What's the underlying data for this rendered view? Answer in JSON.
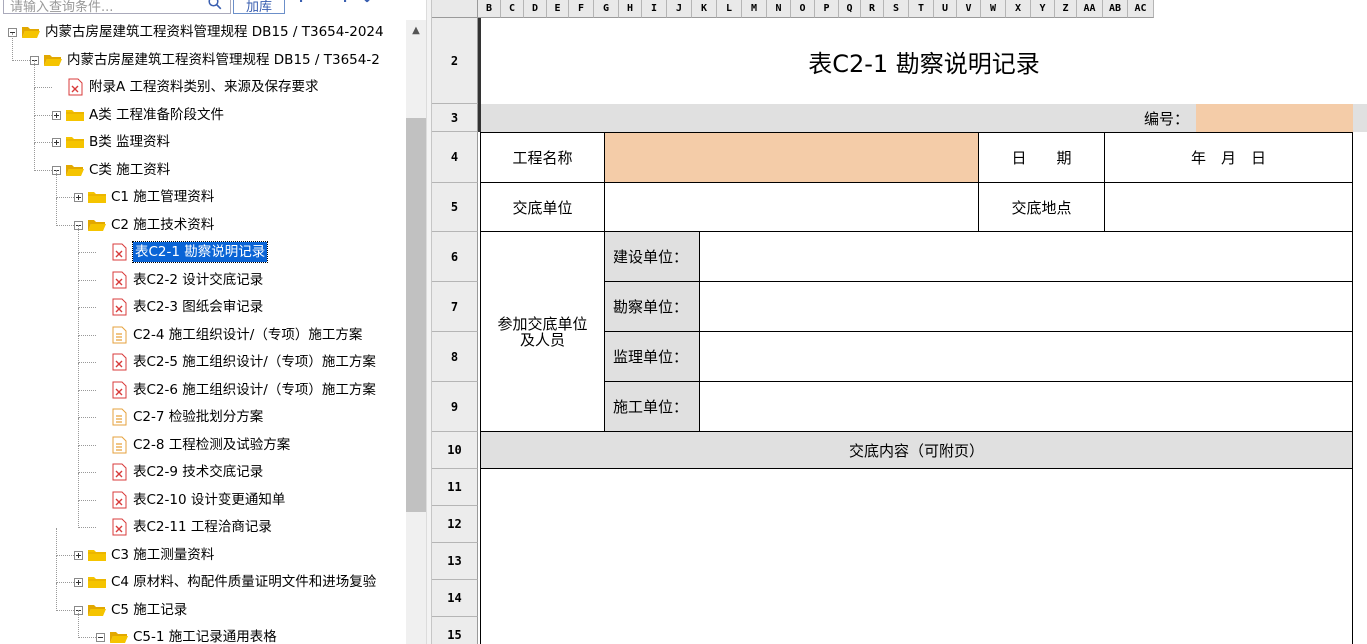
{
  "left_panel": {
    "search_placeholder": "请输入查询条件...",
    "load_button": "加库",
    "tree": [
      {
        "label": "内蒙古房屋建筑工程资料管理规程 DB15 / T3654-2024",
        "icon": "folder-icon",
        "state": "open"
      },
      {
        "label": "内蒙古房屋建筑工程资料管理规程 DB15 / T3654-2",
        "icon": "folder-icon",
        "state": "open"
      },
      {
        "label": "附录A  工程资料类别、来源及保存要求",
        "icon": "excel-file-icon",
        "state": "leaf"
      },
      {
        "label": "A类 工程准备阶段文件",
        "icon": "folder-icon",
        "state": "closed"
      },
      {
        "label": "B类 监理资料",
        "icon": "folder-icon",
        "state": "closed"
      },
      {
        "label": "C类 施工资料",
        "icon": "folder-icon",
        "state": "open"
      },
      {
        "label": "C1 施工管理资料",
        "icon": "folder-icon",
        "state": "closed"
      },
      {
        "label": "C2 施工技术资料",
        "icon": "folder-icon",
        "state": "open"
      },
      {
        "label": "表C2-1 勘察说明记录",
        "icon": "excel-file-icon",
        "state": "leaf",
        "selected": true
      },
      {
        "label": "表C2-2 设计交底记录",
        "icon": "excel-file-icon",
        "state": "leaf"
      },
      {
        "label": "表C2-3 图纸会审记录",
        "icon": "excel-file-icon",
        "state": "leaf"
      },
      {
        "label": "C2-4 施工组织设计/（专项）施工方案",
        "icon": "word-file-icon",
        "state": "leaf"
      },
      {
        "label": "表C2-5 施工组织设计/（专项）施工方案",
        "icon": "excel-file-icon",
        "state": "leaf"
      },
      {
        "label": "表C2-6 施工组织设计/（专项）施工方案",
        "icon": "excel-file-icon",
        "state": "leaf"
      },
      {
        "label": "C2-7 检验批划分方案",
        "icon": "word-file-icon",
        "state": "leaf"
      },
      {
        "label": "C2-8 工程检测及试验方案",
        "icon": "word-file-icon",
        "state": "leaf"
      },
      {
        "label": "表C2-9 技术交底记录",
        "icon": "excel-file-icon",
        "state": "leaf"
      },
      {
        "label": "表C2-10 设计变更通知单",
        "icon": "excel-file-icon",
        "state": "leaf"
      },
      {
        "label": "表C2-11 工程洽商记录",
        "icon": "excel-file-icon",
        "state": "leaf"
      },
      {
        "label": "C3 施工测量资料",
        "icon": "folder-icon",
        "state": "closed"
      },
      {
        "label": "C4 原材料、构配件质量证明文件和进场复验",
        "icon": "folder-icon",
        "state": "closed"
      },
      {
        "label": "C5 施工记录",
        "icon": "folder-icon",
        "state": "open"
      },
      {
        "label": "C5-1 施工记录通用表格",
        "icon": "folder-icon",
        "state": "open"
      }
    ]
  },
  "sheet": {
    "columns": [
      "B",
      "C",
      "D",
      "E",
      "F",
      "G",
      "H",
      "I",
      "J",
      "K",
      "L",
      "M",
      "N",
      "O",
      "P",
      "Q",
      "R",
      "S",
      "T",
      "U",
      "V",
      "W",
      "X",
      "Y",
      "Z",
      "AA",
      "AB",
      "AC"
    ],
    "rows": [
      "2",
      "3",
      "4",
      "5",
      "6",
      "7",
      "8",
      "9",
      "10",
      "11",
      "12",
      "13",
      "14",
      "15"
    ],
    "form": {
      "title": "表C2-1 勘察说明记录",
      "number_label": "编号：",
      "project_name_label": "工程名称",
      "date_label": "日　　期",
      "date_value": "年　月　日",
      "handover_unit_label": "交底单位",
      "handover_place_label": "交底地点",
      "participants_label": "参加交底单位及人员",
      "construction_unit_label": "建设单位：",
      "survey_unit_label": "勘察单位：",
      "supervision_unit_label": "监理单位：",
      "contractor_unit_label": "施工单位：",
      "content_label": "交底内容（可附页）"
    }
  },
  "colors": {
    "selection": "#0a64d6",
    "input_cell": "#f4cca8",
    "label_cell": "#e0e0e0",
    "folder": "#f5c400",
    "excel_icon": "#d83b3b",
    "word_icon": "#e6a23c"
  }
}
